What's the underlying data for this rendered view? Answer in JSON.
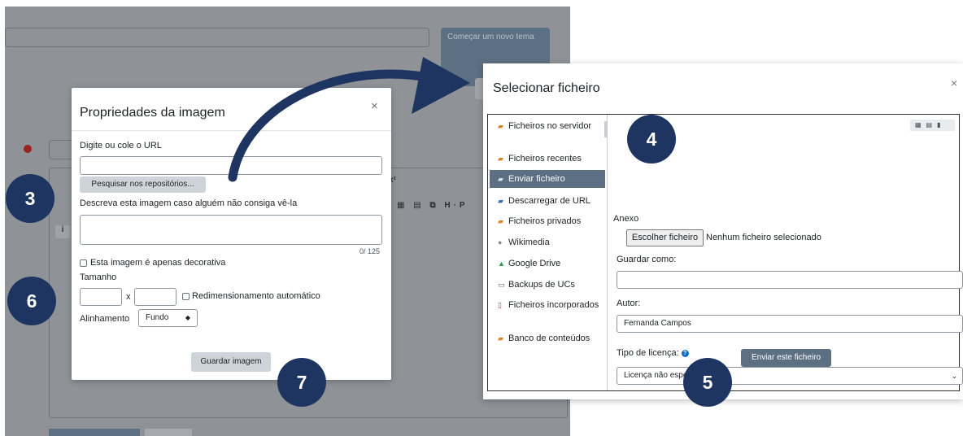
{
  "background": {
    "new_topic_button": "Começar um novo tema",
    "toolbar_sup": "x²",
    "toolbar_info": "i",
    "toolbar_icons": "▦ ▤ ⧉ H·P"
  },
  "image_dialog": {
    "title": "Propriedades da imagem",
    "close": "×",
    "url_label": "Digite ou cole o URL",
    "url_value": "",
    "repo_button": "Pesquisar nos repositórios...",
    "alt_label": "Descreva esta imagem caso alguém não consiga vê-la",
    "alt_value": "",
    "char_count": "0/ 125",
    "decorative_label": "Esta imagem é apenas decorativa",
    "size_label": "Tamanho",
    "size_sep": "x",
    "auto_resize_label": "Redimensionamento automático",
    "align_label": "Alinhamento",
    "align_value": "Fundo",
    "save_button": "Guardar imagem"
  },
  "file_dialog": {
    "title": "Selecionar ficheiro",
    "close": "×",
    "repositories": [
      {
        "label": "Ficheiros no servidor",
        "icon": "folder-icon"
      },
      {
        "label": "Ficheiros recentes",
        "icon": "folder-icon"
      },
      {
        "label": "Enviar ficheiro",
        "icon": "upload-icon"
      },
      {
        "label": "Descarregar de URL",
        "icon": "download-icon"
      },
      {
        "label": "Ficheiros privados",
        "icon": "folder-icon"
      },
      {
        "label": "Wikimedia",
        "icon": "wikimedia-icon"
      },
      {
        "label": "Google Drive",
        "icon": "google-drive-icon"
      },
      {
        "label": "Backups de UCs",
        "icon": "backup-icon"
      },
      {
        "label": "Ficheiros incorporados",
        "icon": "file-icon"
      },
      {
        "label": "Banco de conteúdos",
        "icon": "folder-icon"
      }
    ],
    "active_repository": "Enviar ficheiro",
    "attachment_label": "Anexo",
    "choose_file_button": "Escolher ficheiro",
    "no_file_text": "Nenhum ficheiro selecionado",
    "save_as_label": "Guardar como:",
    "save_as_value": "",
    "author_label": "Autor:",
    "author_value": "Fernanda Campos",
    "license_label": "Tipo de licença:",
    "license_value": "Licença não especificada",
    "upload_button": "Enviar este ficheiro"
  },
  "steps": {
    "step3": "3",
    "step4": "4",
    "step5": "5",
    "step6": "6",
    "step7": "7"
  },
  "colors": {
    "badge": "#1f3561",
    "arrow": "#1f3561",
    "primary_button": "#5d7083",
    "overlay": "#8f9296"
  }
}
